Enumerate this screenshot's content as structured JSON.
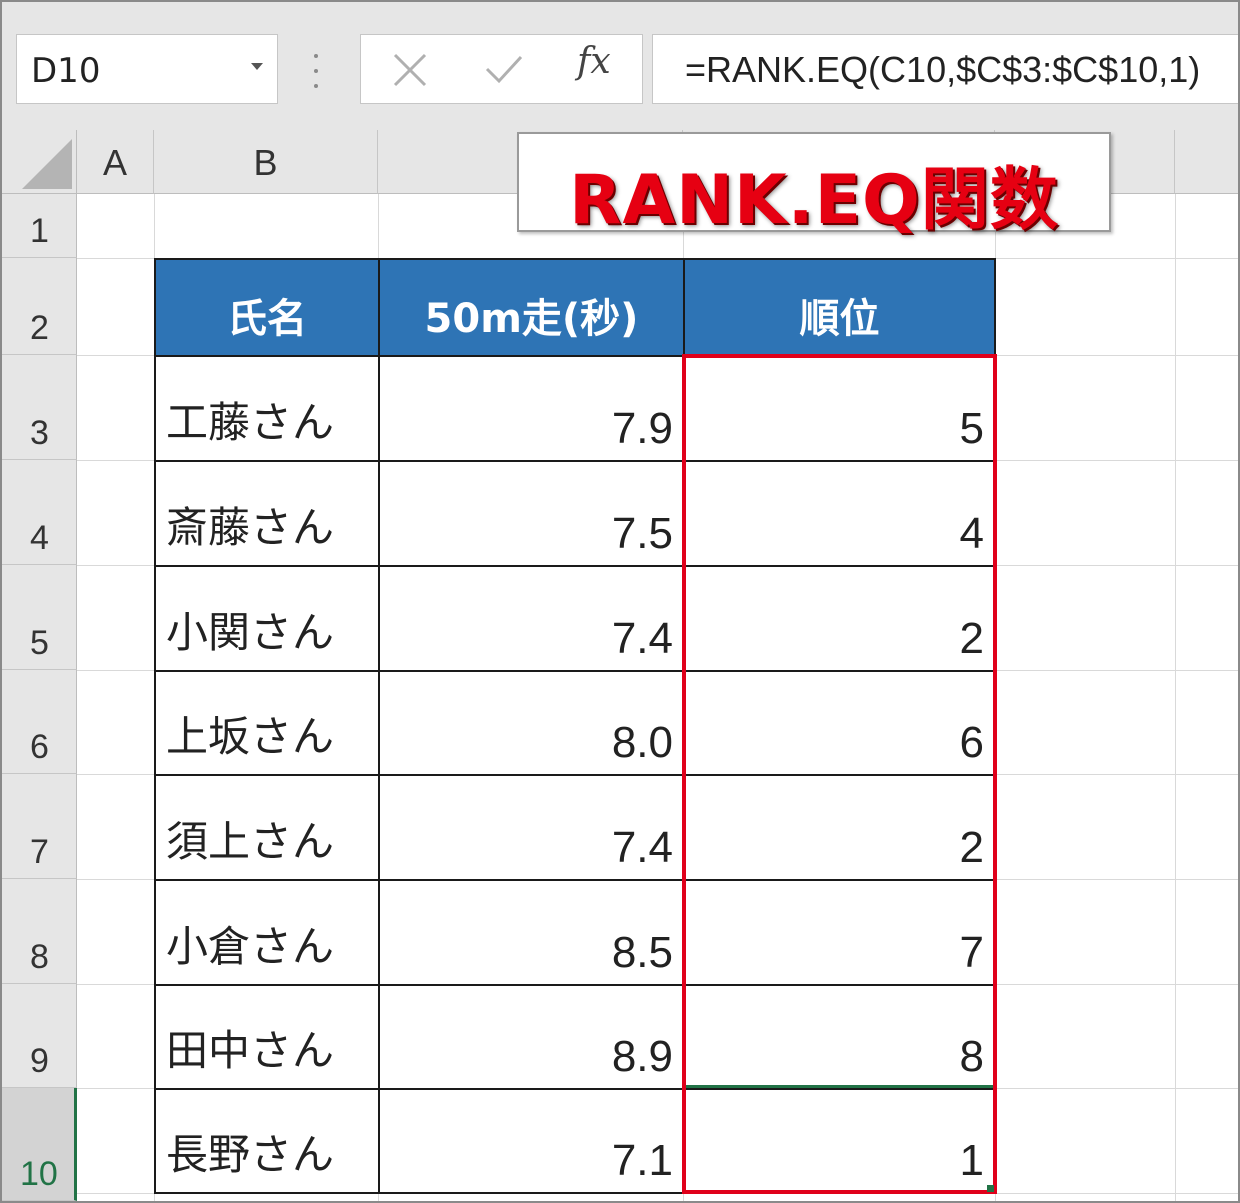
{
  "formula_bar": {
    "name_box": "D10",
    "formula": "=RANK.EQ(C10,$C$3:$C$10,1)",
    "fx_label": "fx"
  },
  "columns": [
    "A",
    "B"
  ],
  "rows": [
    "1",
    "2",
    "3",
    "4",
    "5",
    "6",
    "7",
    "8",
    "9",
    "10"
  ],
  "callout": {
    "text": "RANK.EQ関数"
  },
  "table": {
    "headers": [
      "氏名",
      "50m走(秒)",
      "順位"
    ],
    "rows": [
      {
        "name": "工藤さん",
        "time": "7.9",
        "rank": "5"
      },
      {
        "name": "斎藤さん",
        "time": "7.5",
        "rank": "4"
      },
      {
        "name": "小関さん",
        "time": "7.4",
        "rank": "2"
      },
      {
        "name": "上坂さん",
        "time": "8.0",
        "rank": "6"
      },
      {
        "name": "須上さん",
        "time": "7.4",
        "rank": "2"
      },
      {
        "name": "小倉さん",
        "time": "8.5",
        "rank": "7"
      },
      {
        "name": "田中さん",
        "time": "8.9",
        "rank": "8"
      },
      {
        "name": "長野さん",
        "time": "7.1",
        "rank": "1"
      }
    ]
  },
  "colors": {
    "header_fill": "#2e74b5",
    "highlight_border": "#e0001a",
    "callout_text": "#e60012",
    "selection": "#217346"
  }
}
